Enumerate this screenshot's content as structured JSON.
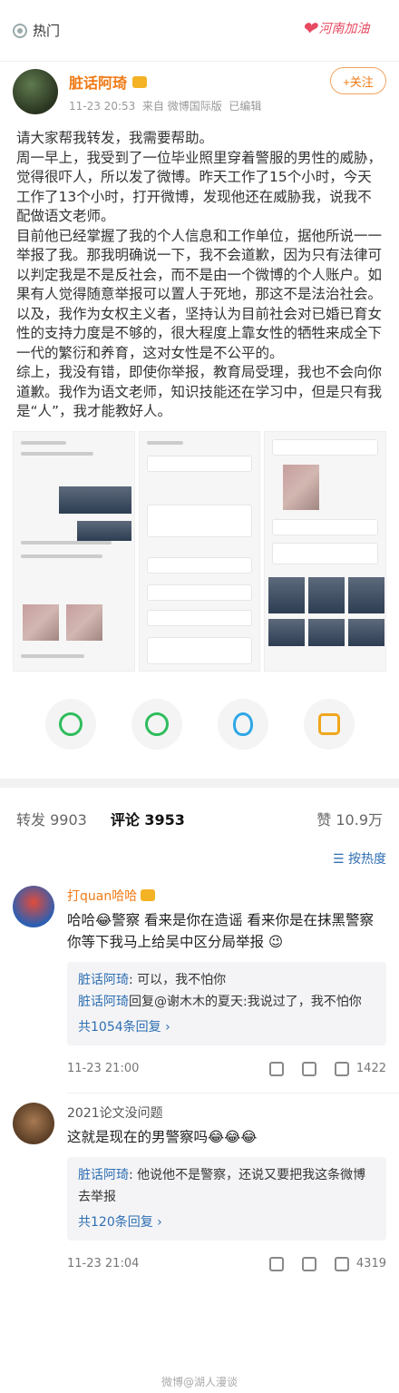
{
  "topbar": {
    "section_label": "热门",
    "banner_text": "河南加油"
  },
  "post": {
    "author": "脏话阿琦",
    "time": "11-23 20:53",
    "source": "来自 微博国际版",
    "edited": "已编辑",
    "follow_label": "+关注",
    "paragraphs": [
      "请大家帮我转发，我需要帮助。",
      "周一早上，我受到了一位毕业照里穿着警服的男性的威胁，觉得很吓人，所以发了微博。昨天工作了15个小时，今天工作了13个小时，打开微博，发现他还在威胁我，说我不配做语文老师。",
      "目前他已经掌握了我的个人信息和工作单位，据他所说一一举报了我。那我明确说一下，我不会道歉，因为只有法律可以判定我是不是反社会，而不是由一个微博的个人账户。如果有人觉得随意举报可以置人于死地，那这不是法治社会。",
      "以及，我作为女权主义者，坚持认为目前社会对已婚已育女性的支持力度是不够的，很大程度上靠女性的牺牲来成全下一代的繁衍和养育，这对女性是不公平的。",
      "综上，我没有错，即使你举报，教育局受理，我也不会向你道歉。我作为语文老师，知识技能还在学习中，但是只有我是“人”，我才能教好人。"
    ]
  },
  "share_icons": [
    "wechat-icon",
    "moments-icon",
    "qq-icon",
    "photo-icon"
  ],
  "tabs": {
    "repost": "转发 9903",
    "comments": "评论 3953",
    "likes": "赞 10.9万"
  },
  "sort_label": "按热度",
  "comments": [
    {
      "name": "打quan哈哈",
      "text": "哈哈😂警察  看来是你在造谣 看来你是在抹黑警察 你等下我马上给吴中区分局举报 😉",
      "replies": [
        {
          "user": "脏话阿琦",
          "text": ": 可以，我不怕你"
        },
        {
          "user": "脏话阿琦",
          "text": "回复@谢木木的夏天:我说过了，我不怕你"
        }
      ],
      "more": "共1054条回复 ›",
      "time": "11-23 21:00",
      "likes": "1422"
    },
    {
      "name": "2021论文没问题",
      "text": "这就是现在的男警察吗😂😂😂",
      "replies": [
        {
          "user": "脏话阿琦",
          "text": ": 他说他不是警察，还说又要把我这条微博去举报"
        }
      ],
      "more": "共120条回复 ›",
      "time": "11-23 21:04",
      "likes": "4319"
    }
  ],
  "watermark": "微博@湖人漫谈"
}
